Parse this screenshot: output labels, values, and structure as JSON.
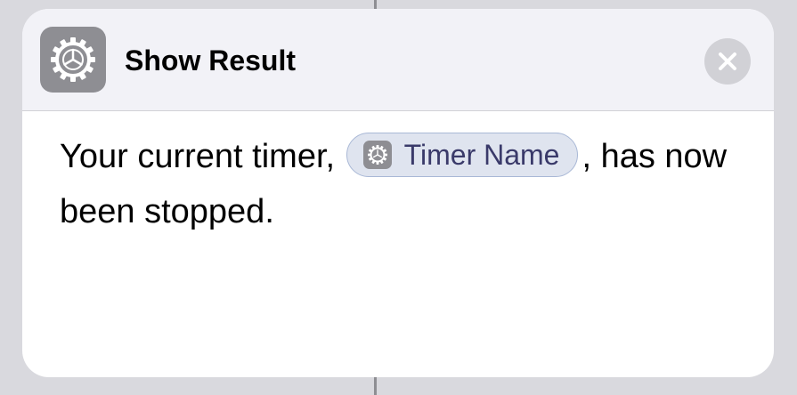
{
  "header": {
    "title": "Show Result",
    "app_icon": "gear-icon",
    "close_icon": "close-icon"
  },
  "body": {
    "text_before": "Your current timer,",
    "variable_token": {
      "icon": "gear-icon",
      "label": "Timer Name"
    },
    "text_after": ", has now been stopped."
  },
  "colors": {
    "background": "#d9d9de",
    "card": "#ffffff",
    "header": "#f2f2f7",
    "icon_bg": "#8e8e93",
    "token_bg": "#dfe4ef",
    "token_text": "#3a3a6a"
  }
}
